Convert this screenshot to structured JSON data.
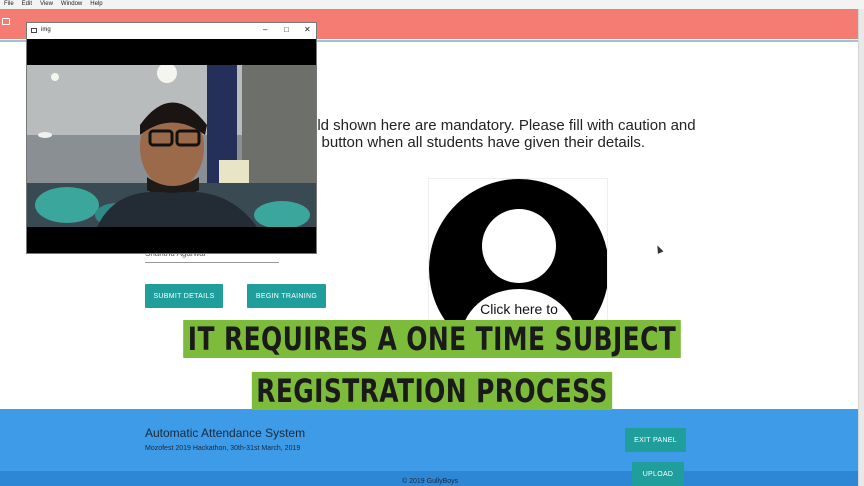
{
  "menu": [
    "File",
    "Edit",
    "View",
    "Window",
    "Help"
  ],
  "instructions": {
    "line1": "eld shown here are mandatory. Please fill with caution and",
    "line2": "n button when all students have given their details."
  },
  "form": {
    "name_value": "Shantnu Agarwal",
    "submit_label": "SUBMIT DETAILS",
    "train_label": "BEGIN TRAINING"
  },
  "avatar": {
    "caption": "Click here to"
  },
  "overlay_caption": {
    "line1": "IT REQUIRES A ONE TIME SUBJECT",
    "line2": "REGISTRATION PROCESS"
  },
  "footer": {
    "title": "Automatic Attendance System",
    "subtitle": "Mozofest 2019 Hackathon, 30th-31st March, 2019",
    "exit_label": "EXIT PANEL",
    "upload_label": "UPLOAD",
    "copyright": "© 2019 GullyBoys"
  },
  "video_window": {
    "title": "img",
    "minimize": "–",
    "maximize": "□",
    "close": "✕"
  },
  "colors": {
    "top_band": "#f57c73",
    "footer": "#3d9be8",
    "button": "#1f9e9c",
    "caption_highlight": "#7dbb3b"
  },
  "icons": [
    "chat-icon",
    "window-app-icon",
    "avatar-placeholder-icon",
    "mouse-cursor-icon"
  ]
}
